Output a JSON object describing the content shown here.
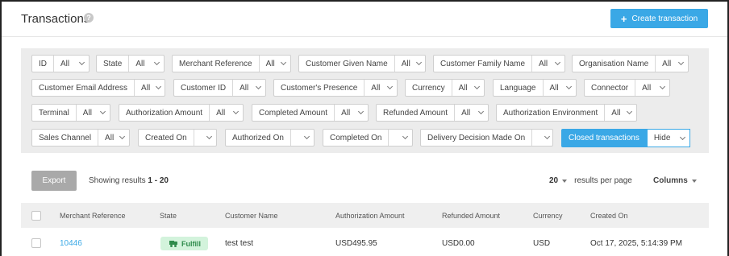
{
  "header": {
    "title": "Transactions",
    "help_icon": "?",
    "create_button": "Create transaction"
  },
  "filters": [
    {
      "label": "ID",
      "value": "All"
    },
    {
      "label": "State",
      "value": "All"
    },
    {
      "label": "Merchant Reference",
      "value": "All"
    },
    {
      "label": "Customer Given Name",
      "value": "All"
    },
    {
      "label": "Customer Family Name",
      "value": "All"
    },
    {
      "label": "Organisation Name",
      "value": "All"
    },
    {
      "label": "Customer Email Address",
      "value": "All"
    },
    {
      "label": "Customer ID",
      "value": "All"
    },
    {
      "label": "Customer's Presence",
      "value": "All"
    },
    {
      "label": "Currency",
      "value": "All"
    },
    {
      "label": "Language",
      "value": "All"
    },
    {
      "label": "Connector",
      "value": "All"
    },
    {
      "label": "Terminal",
      "value": "All"
    },
    {
      "label": "Authorization Amount",
      "value": "All"
    },
    {
      "label": "Completed Amount",
      "value": "All"
    },
    {
      "label": "Refunded Amount",
      "value": "All"
    },
    {
      "label": "Authorization Environment",
      "value": "All"
    },
    {
      "label": "Sales Channel",
      "value": "All"
    },
    {
      "label": "Created On",
      "value": ""
    },
    {
      "label": "Authorized On",
      "value": ""
    },
    {
      "label": "Completed On",
      "value": ""
    },
    {
      "label": "Delivery Decision Made On",
      "value": ""
    }
  ],
  "closed_transactions": {
    "label": "Closed transactions",
    "value": "Hide"
  },
  "toolbar": {
    "export": "Export",
    "showing_prefix": "Showing results",
    "showing_range": "1 - 20",
    "per_page_value": "20",
    "per_page_label": "results per page",
    "columns": "Columns"
  },
  "table": {
    "headers": [
      "Merchant Reference",
      "State",
      "Customer Name",
      "Authorization Amount",
      "Refunded Amount",
      "Currency",
      "Created On"
    ],
    "rows": [
      {
        "merchant_reference": "10446",
        "state": "Fulfill",
        "customer_name": "test test",
        "authorization_amount": "USD495.95",
        "refunded_amount": "USD0.00",
        "currency": "USD",
        "created_on": "Oct 17, 2025, 5:14:39 PM"
      }
    ]
  },
  "colors": {
    "accent": "#3aa8e6",
    "badge_bg": "#d3f3dc",
    "badge_text": "#2e8b4b"
  }
}
